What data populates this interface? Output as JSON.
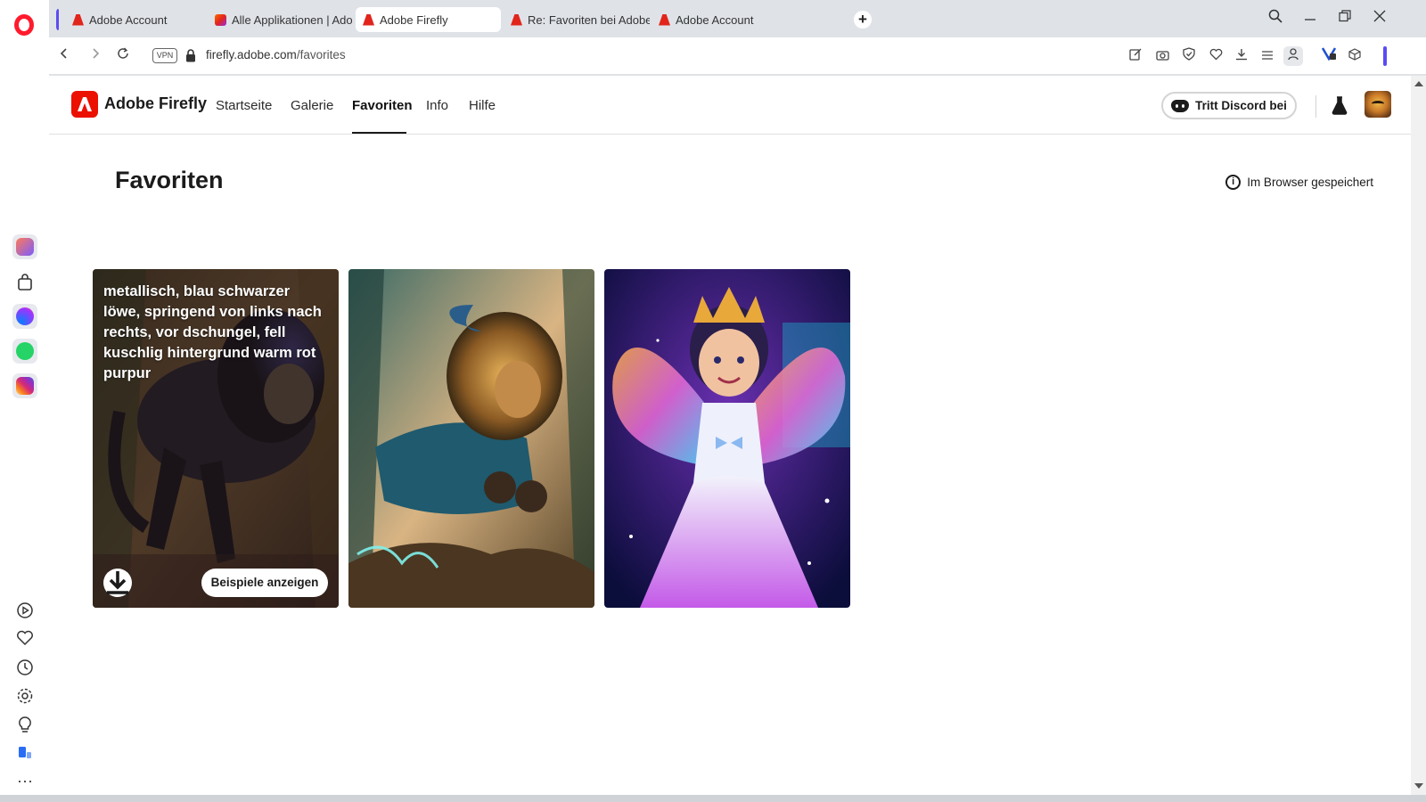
{
  "browser": {
    "tabs": [
      {
        "label": "Adobe Account",
        "favicon": "adobe-icon"
      },
      {
        "label": "Alle Applikationen | Adob",
        "favicon": "creative-cloud-icon"
      },
      {
        "label": "Adobe Firefly",
        "favicon": "adobe-icon",
        "active": true
      },
      {
        "label": "Re: Favoriten bei Adobe F",
        "favicon": "adobe-icon"
      },
      {
        "label": "Adobe Account",
        "favicon": "adobe-icon"
      }
    ],
    "vpn_label": "VPN",
    "url_host": "firefly.adobe.com",
    "url_path": "/favorites"
  },
  "firefly": {
    "brand": "Adobe Firefly",
    "nav": [
      "Startseite",
      "Galerie",
      "Favoriten",
      "Info",
      "Hilfe"
    ],
    "active_nav": "Favoriten",
    "discord_label": "Tritt Discord bei",
    "page_title": "Favoriten",
    "stored_note": "Im Browser gespeichert",
    "cards": [
      {
        "subject": "metallic blue-black lion leaping",
        "prompt": "metallisch, blau schwarzer löwe, springend von links nach rechts, vor dschungel, fell kuschlig hintergrund warm rot purpur",
        "download_icon": "download-icon",
        "examples_label": "Beispiele anzeigen"
      },
      {
        "subject": "golden lion leaping in jungle"
      },
      {
        "subject": "smiling fairy girl with crown and rainbow wings"
      }
    ]
  },
  "colors": {
    "adobe_red": "#eb1000",
    "opera_red": "#ff1b2d",
    "text": "#1b1b1b"
  }
}
